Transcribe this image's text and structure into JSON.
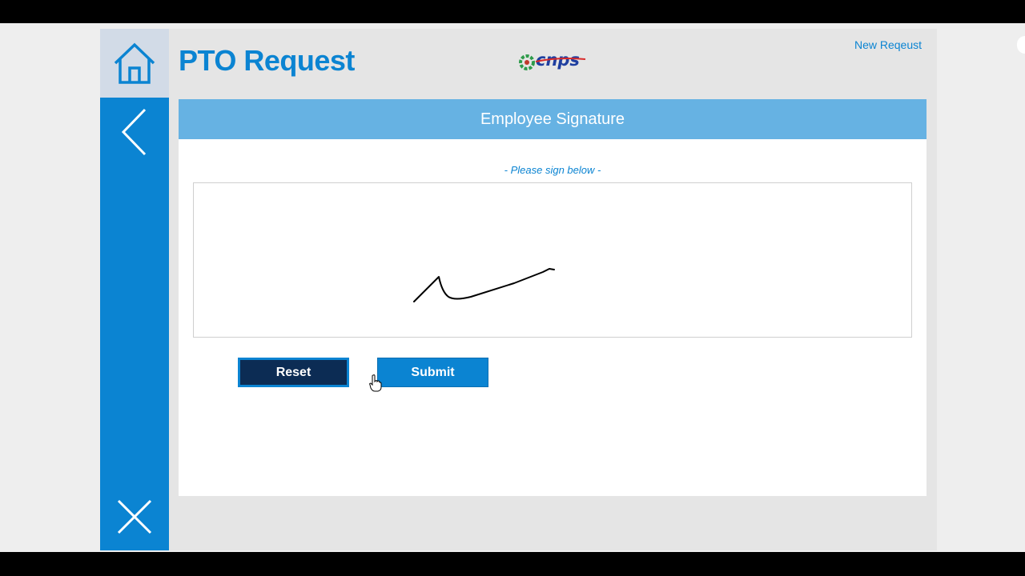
{
  "window": {
    "title": "PTO Request"
  },
  "header": {
    "title": "PTO Request",
    "logo_text": "cnps",
    "new_request_link": "New Reqeust"
  },
  "rail": {
    "home_icon": "home-icon",
    "back_icon": "chevron-left-icon",
    "close_icon": "close-icon"
  },
  "panel": {
    "header": "Employee Signature",
    "hint": "- Please sign below -"
  },
  "actions": {
    "reset_label": "Reset",
    "submit_label": "Submit"
  },
  "colors": {
    "primary": "#0b84d2",
    "panel_header": "#66b2e3",
    "reset_bg": "#0c2c54",
    "rail_home_bg": "#d2dbe7"
  }
}
